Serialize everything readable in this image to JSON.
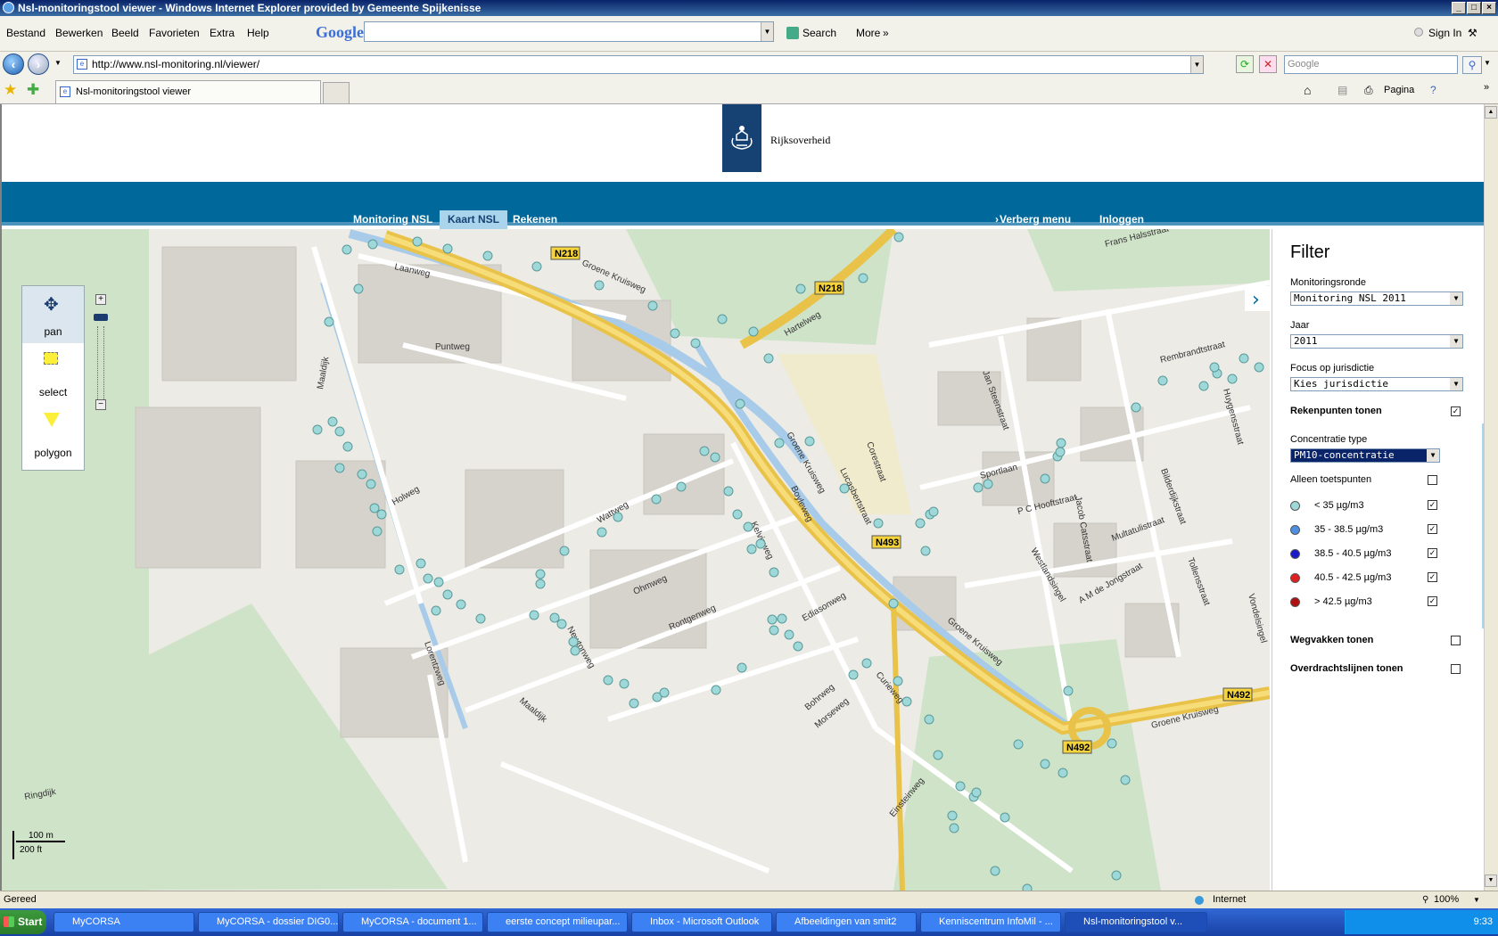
{
  "window": {
    "title": "Nsl-monitoringstool viewer - Windows Internet Explorer provided by Gemeente Spijkenisse"
  },
  "menu": [
    "Bestand",
    "Bewerken",
    "Beeld",
    "Favorieten",
    "Extra",
    "Help"
  ],
  "google_toolbar": {
    "logo": "Google",
    "search_label": "Search",
    "more_label": "More",
    "signin_label": "Sign In"
  },
  "address": {
    "url": "http://www.nsl-monitoring.nl/viewer/",
    "search_placeholder": "Google"
  },
  "tabs": {
    "active": "Nsl-monitoringstool viewer",
    "pagina_label": "Pagina"
  },
  "site": {
    "org_name": "Rijksoverheid",
    "nav": [
      "Monitoring NSL",
      "Kaart NSL",
      "Rekenen"
    ],
    "nav_right": [
      "Verberg menu",
      "Inloggen"
    ]
  },
  "map_tools": {
    "pan": "pan",
    "select": "select",
    "polygon": "polygon"
  },
  "map_labels": {
    "roads": [
      "N218",
      "N218",
      "N493",
      "N492",
      "N492"
    ],
    "streets": [
      "Groene Kruisweg",
      "Hartelweg",
      "Laanweg",
      "Puntweg",
      "Maaldijk",
      "Holweg",
      "Wattweg",
      "Ohmweg",
      "Kelvinweg",
      "Boyleweg",
      "Lucasbertstraat",
      "Corestraat",
      "Rontgenweg",
      "Newtonweg",
      "Lorentzweg",
      "Ediasonweg",
      "Bohrweg",
      "Morseweg",
      "Curieweg",
      "Einsteinweg",
      "Ringdijk",
      "Jan Steenstraat",
      "Rembrandtstraat",
      "Sportlaan",
      "P C Hooftstraat",
      "Jacob Catsstraat",
      "Multatulistraat",
      "Bilderdijkstraat",
      "Tollensstraat",
      "A M de Jongstraat",
      "Westlandsingel",
      "Frans Halsstraat",
      "Huygensstraat",
      "Vondelsingel"
    ],
    "scale_m": "100 m",
    "scale_ft": "200 ft"
  },
  "filter": {
    "title": "Filter",
    "monitoringsronde_label": "Monitoringsronde",
    "monitoringsronde_value": "Monitoring NSL 2011",
    "jaar_label": "Jaar",
    "jaar_value": "2011",
    "focus_label": "Focus op jurisdictie",
    "focus_value": "Kies jurisdictie",
    "rekenpunten_label": "Rekenpunten tonen",
    "concentratie_label": "Concentratie type",
    "concentratie_value": "PM10-concentratie",
    "toetspunten_label": "Alleen toetspunten",
    "legend": [
      {
        "label": "< 35 µg/m3",
        "color": "#9fd8d8",
        "checked": true
      },
      {
        "label": "35 - 38.5 µg/m3",
        "color": "#4f8fe0",
        "checked": true
      },
      {
        "label": "38.5 - 40.5 µg/m3",
        "color": "#1a1ac8",
        "checked": true
      },
      {
        "label": "40.5 - 42.5 µg/m3",
        "color": "#e02020",
        "checked": true
      },
      {
        "label": "> 42.5 µg/m3",
        "color": "#b01010",
        "checked": true
      }
    ],
    "wegvakken_label": "Wegvakken tonen",
    "overdracht_label": "Overdrachtslijnen tonen"
  },
  "status": {
    "left": "Gereed",
    "zone": "Internet",
    "zoom": "100%"
  },
  "taskbar": {
    "start": "Start",
    "items": [
      "MyCORSA",
      "MyCORSA - dossier DIG0...",
      "MyCORSA - document 1...",
      "eerste concept milieupar...",
      "Inbox - Microsoft Outlook",
      "Afbeeldingen van smit2",
      "Kenniscentrum InfoMil - ...",
      "Nsl-monitoringstool v..."
    ],
    "clock": "9:33"
  }
}
